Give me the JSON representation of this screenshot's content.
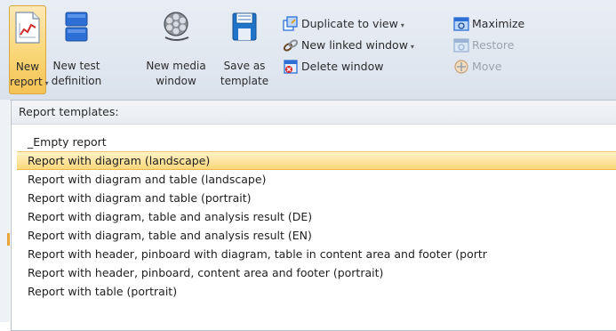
{
  "ribbon": {
    "new_report": {
      "line1": "New",
      "line2": "report",
      "caret": "▾"
    },
    "new_test_definition": {
      "line1": "New test",
      "line2": "definition"
    },
    "new_media_window": {
      "line1": "New media",
      "line2": "window"
    },
    "save_as_template": {
      "line1": "Save as",
      "line2": "template"
    },
    "duplicate_to_view": {
      "label": "Duplicate to view",
      "caret": "▾"
    },
    "new_linked_window": {
      "label": "New linked window",
      "caret": "▾"
    },
    "delete_window": {
      "label": "Delete window"
    },
    "maximize": {
      "label": "Maximize"
    },
    "restore": {
      "label": "Restore"
    },
    "move": {
      "label": "Move"
    }
  },
  "dropdown": {
    "header": "Report templates:",
    "items": [
      "_Empty report",
      "Report with diagram (landscape)",
      "Report with diagram and table (landscape)",
      "Report with diagram and table (portrait)",
      "Report with diagram, table and analysis result (DE)",
      "Report with diagram, table and analysis result (EN)",
      "Report with header, pinboard with diagram, table in content area and footer (portr",
      "Report with header, pinboard, content area and footer (portrait)",
      "Report with table (portrait)"
    ],
    "highlighted_index": 1
  },
  "colors": {
    "ribbon_bg": "#dfe6ef",
    "active_button": "#f9d676",
    "highlight_row": "#fde39a",
    "disabled_text": "#9aa3ad"
  }
}
